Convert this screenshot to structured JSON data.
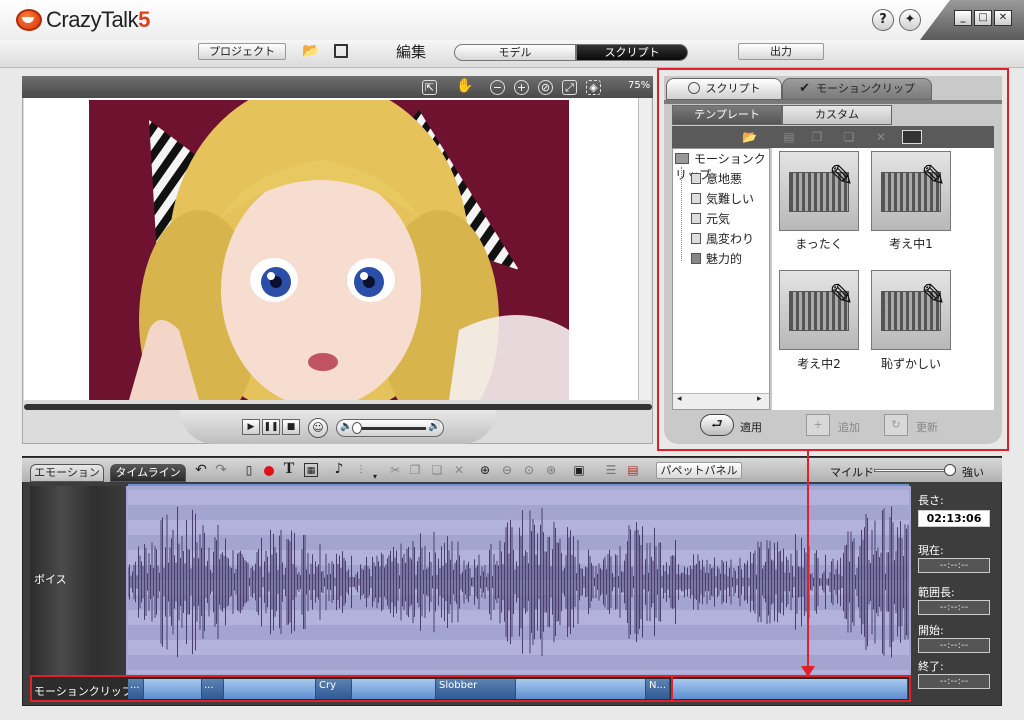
{
  "app": {
    "name": "CrazyTalk",
    "version": "5"
  },
  "title_buttons": {
    "help": "?"
  },
  "menu": {
    "project": "プロジェクト",
    "edit_label": "編集",
    "model": "モデル",
    "script": "スクリプト",
    "output": "出力"
  },
  "preview": {
    "zoom": "75%"
  },
  "right_panel": {
    "tabs": {
      "script": "スクリプト",
      "motion_clip": "モーションクリップ"
    },
    "subtabs": {
      "template": "テンプレート",
      "custom": "カスタム"
    },
    "tree": {
      "root": "モーションクリップ",
      "items": [
        "意地悪",
        "気難しい",
        "元気",
        "風変わり",
        "魅力的"
      ]
    },
    "thumbnails": [
      "まったく",
      "考え中1",
      "考え中2",
      "恥ずかしい"
    ],
    "buttons": {
      "apply": "適用",
      "add": "追加",
      "update": "更新"
    }
  },
  "bottom": {
    "tabs": {
      "emotion": "エモーション",
      "timeline": "タイムライン"
    },
    "puppet_panel": "パペットパネル",
    "mild": "マイルド",
    "strong": "強い",
    "track_voice": "ボイス",
    "track_motion": "モーションクリップ",
    "stats": {
      "length_label": "長さ:",
      "length_value": "02:13:06",
      "current_label": "現在:",
      "range_label": "範囲長:",
      "start_label": "開始:",
      "end_label": "終了:",
      "placeholder": "--:--:--"
    },
    "clips": [
      "...",
      "...",
      "Cry",
      "Slobber",
      "N..."
    ]
  },
  "colors": {
    "accent_red": "#e0202a",
    "clip_blue": "#5c8ed0",
    "wave": "#4a3f6e",
    "portrait_bg": "#6e1230"
  }
}
